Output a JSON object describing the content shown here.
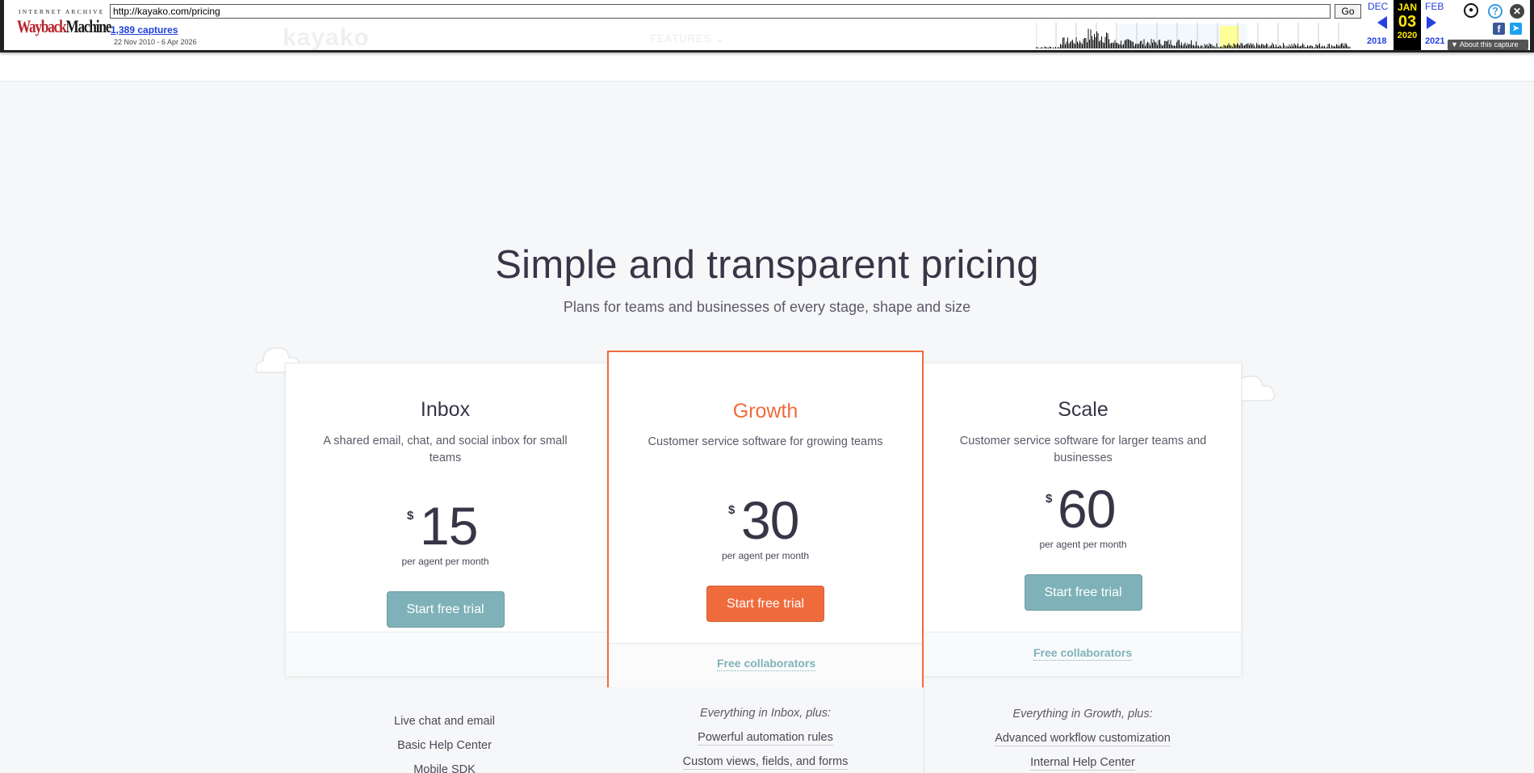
{
  "wayback": {
    "logo_top": "INTERNET ARCHIVE",
    "logo_main_1": "Wayback",
    "logo_main_2": "Machine",
    "url": "http://kayako.com/pricing",
    "go_label": "Go",
    "captures": "1,389 captures",
    "range": "22 Nov 2010 - 6 Apr 2026",
    "prev_month": "DEC",
    "prev_year": "2018",
    "cur_month": "JAN",
    "cur_day": "03",
    "cur_year": "2020",
    "next_month": "FEB",
    "next_year": "2021",
    "about": "▼ About this capture",
    "icons": [
      "user-icon",
      "help-icon",
      "close-icon",
      "facebook-icon",
      "twitter-icon"
    ]
  },
  "site": {
    "logo_text": "kayako",
    "nav_features": "FEATURES ⌄"
  },
  "hero": {
    "title": "Simple and transparent pricing",
    "subtitle": "Plans for teams and businesses of every stage, shape and size"
  },
  "plans": [
    {
      "name": "Inbox",
      "description": "A shared email, chat, and social inbox for small teams",
      "currency": "$",
      "price": "15",
      "per": "per agent per month",
      "cta": "Start free trial",
      "collaborators": "",
      "features_intro": "",
      "features": [
        "Live chat and email",
        "Basic Help Center",
        "Mobile SDK"
      ]
    },
    {
      "name": "Growth",
      "description": "Customer service software for growing teams",
      "currency": "$",
      "price": "30",
      "per": "per agent per month",
      "cta": "Start free trial",
      "collaborators": "Free collaborators",
      "features_intro": "Everything in Inbox, plus:",
      "features": [
        "Powerful automation rules",
        "Custom views, fields, and forms"
      ]
    },
    {
      "name": "Scale",
      "description": "Customer service software for larger teams and businesses",
      "currency": "$",
      "price": "60",
      "per": "per agent per month",
      "cta": "Start free trial",
      "collaborators": "Free collaborators",
      "features_intro": "Everything in Growth, plus:",
      "features": [
        "Advanced workflow customization",
        "Internal Help Center"
      ]
    }
  ],
  "colors": {
    "accent_orange": "#f06b3c",
    "accent_teal": "#7eb2b8",
    "text_dark": "#3a3447",
    "background": "#f6f7f8"
  }
}
